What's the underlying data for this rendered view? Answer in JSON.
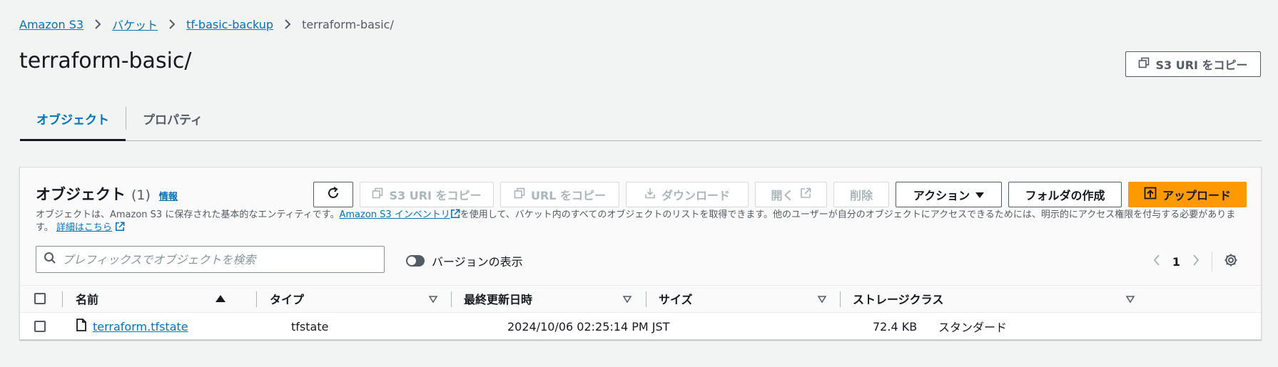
{
  "breadcrumb": {
    "items": [
      "Amazon S3",
      "バケット",
      "tf-basic-backup"
    ],
    "current": "terraform-basic/"
  },
  "page": {
    "title": "terraform-basic/",
    "copy_uri_label": "S3 URI をコピー"
  },
  "tabs": [
    {
      "label": "オブジェクト",
      "active": true
    },
    {
      "label": "プロパティ",
      "active": false
    }
  ],
  "objects_panel": {
    "title": "オブジェクト",
    "count": "(1)",
    "info_label": "情報",
    "toolbar": {
      "copy_s3_uri": "S3 URI をコピー",
      "copy_url": "URL をコピー",
      "download": "ダウンロード",
      "open": "開く",
      "delete": "削除",
      "actions": "アクション",
      "create_folder": "フォルダの作成",
      "upload": "アップロード"
    },
    "description": {
      "part1": "オブジェクトは、Amazon S3 に保存された基本的なエンティティです。",
      "link1": "Amazon S3 インベントリ",
      "part2": "を使用して、バケット内のすべてのオブジェクトのリストを取得できます。他のユーザーが自分のオブジェクトにアクセスできるためには、明示的にアクセス権限を付与する必要があります。",
      "link2": "詳細はこちら"
    },
    "search_placeholder": "プレフィックスでオブジェクトを検索",
    "versions_toggle_label": "バージョンの表示",
    "current_page": "1",
    "columns": [
      "名前",
      "タイプ",
      "最終更新日時",
      "サイズ",
      "ストレージクラス"
    ],
    "rows": [
      {
        "name": "terraform.tfstate",
        "type": "tfstate",
        "modified": "2024/10/06 02:25:14 PM JST",
        "size": "72.4 KB",
        "storage_class": "スタンダード"
      }
    ]
  },
  "colors": {
    "link": "#0073bb",
    "primary": "#ff9900",
    "background": "#f2f3f3",
    "text": "#16191f"
  },
  "icons": [
    "chevron-right-icon",
    "copy-icon",
    "refresh-icon",
    "download-icon",
    "external-link-icon",
    "caret-down-icon",
    "upload-icon",
    "search-icon",
    "chevron-left-icon",
    "gear-icon",
    "sort-asc-icon",
    "sort-desc-icon",
    "file-icon"
  ]
}
